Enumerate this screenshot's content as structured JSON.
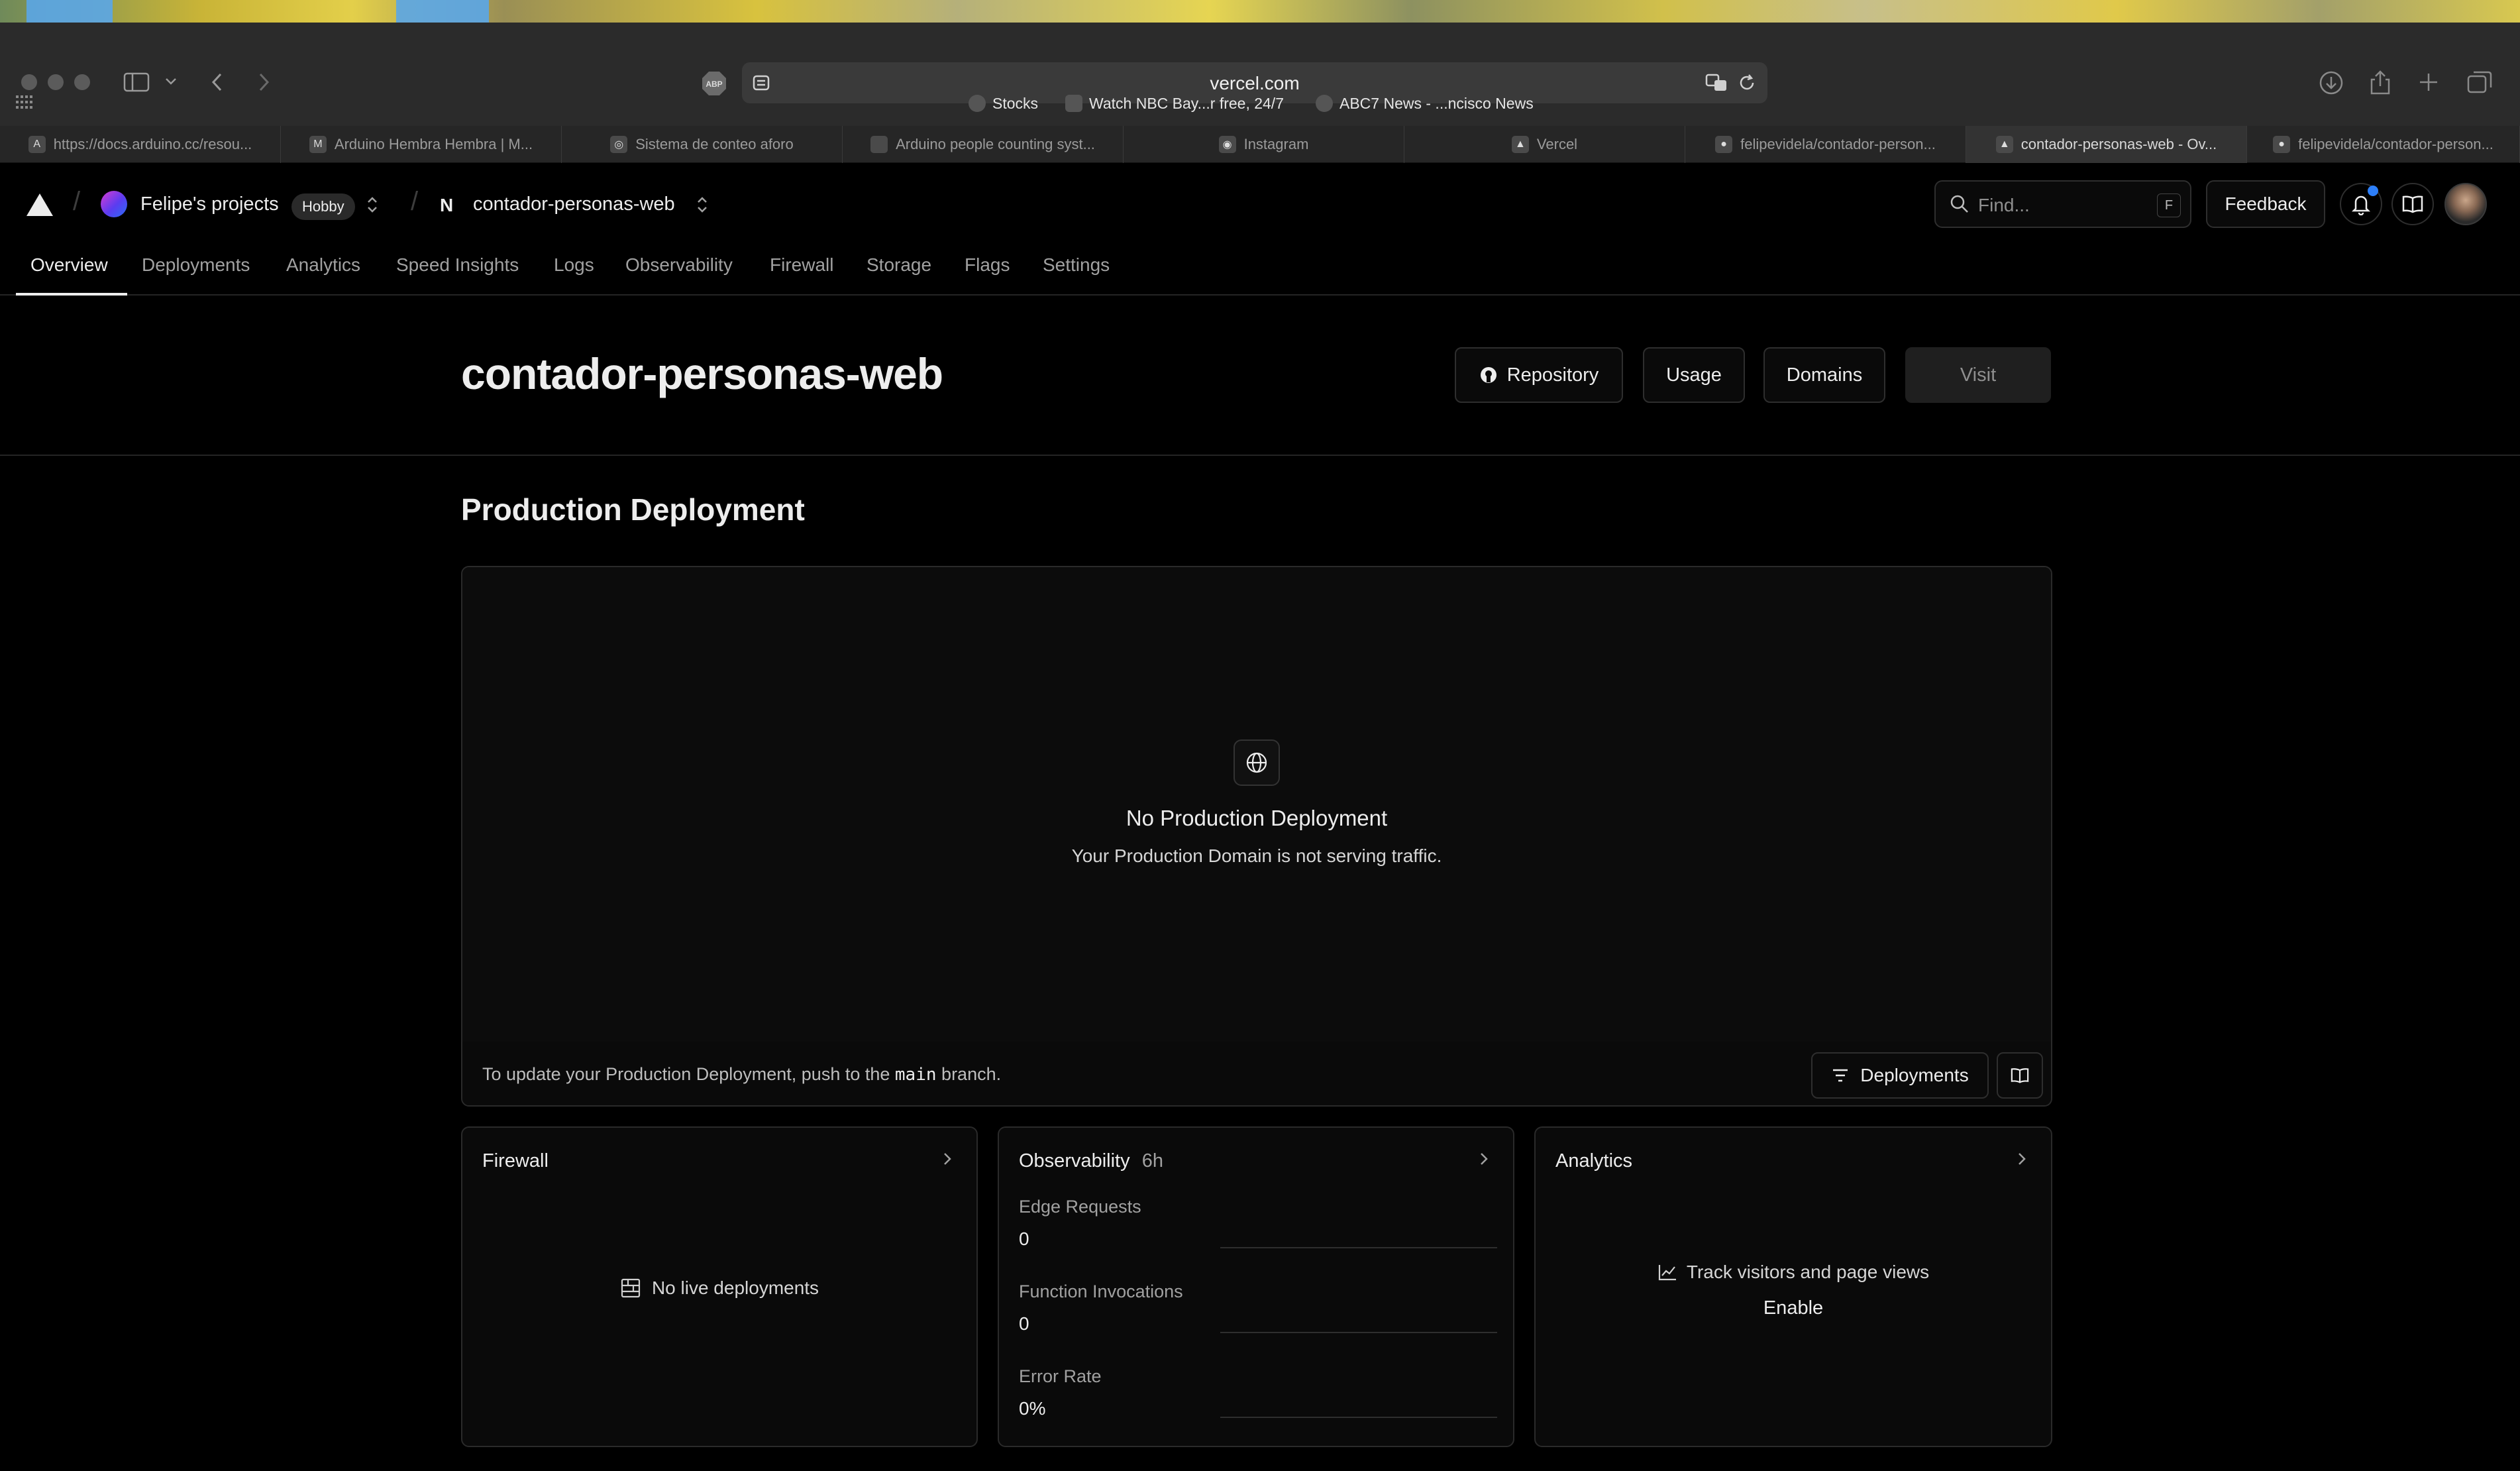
{
  "browser": {
    "url": "vercel.com",
    "bookmarks": [
      {
        "label": "Stocks"
      },
      {
        "label": "Watch NBC Bay...r free, 24/7"
      },
      {
        "label": "ABC7 News - ...ncisco News"
      }
    ],
    "tabs": [
      {
        "label": "https://docs.arduino.cc/resou..."
      },
      {
        "label": "Arduino Hembra Hembra | M..."
      },
      {
        "label": "Sistema de conteo aforo"
      },
      {
        "label": "Arduino people counting syst..."
      },
      {
        "label": "Instagram"
      },
      {
        "label": "Vercel"
      },
      {
        "label": "felipevidela/contador-person..."
      },
      {
        "label": "contador-personas-web - Ov..."
      },
      {
        "label": "felipevidela/contador-person..."
      }
    ],
    "active_tab_index": 7
  },
  "header": {
    "team_name": "Felipe's projects",
    "plan_badge": "Hobby",
    "project_name": "contador-personas-web",
    "find_placeholder": "Find...",
    "find_shortcut": "F",
    "feedback_label": "Feedback"
  },
  "nav": {
    "items": [
      {
        "label": "Overview",
        "active": true
      },
      {
        "label": "Deployments"
      },
      {
        "label": "Analytics"
      },
      {
        "label": "Speed Insights"
      },
      {
        "label": "Logs"
      },
      {
        "label": "Observability"
      },
      {
        "label": "Firewall"
      },
      {
        "label": "Storage"
      },
      {
        "label": "Flags"
      },
      {
        "label": "Settings"
      }
    ]
  },
  "project": {
    "title": "contador-personas-web",
    "buttons": {
      "repository": "Repository",
      "usage": "Usage",
      "domains": "Domains",
      "visit": "Visit"
    }
  },
  "production": {
    "heading": "Production Deployment",
    "empty_title": "No Production Deployment",
    "empty_subtitle": "Your Production Domain is not serving traffic.",
    "footer_prefix": "To update your Production Deployment, push to the",
    "footer_branch": "main",
    "footer_suffix": "branch.",
    "deployments_button": "Deployments"
  },
  "cards": {
    "firewall": {
      "title": "Firewall",
      "empty": "No live deployments"
    },
    "observability": {
      "title": "Observability",
      "range": "6h",
      "metrics": [
        {
          "label": "Edge Requests",
          "value": "0"
        },
        {
          "label": "Function Invocations",
          "value": "0"
        },
        {
          "label": "Error Rate",
          "value": "0%"
        }
      ]
    },
    "analytics": {
      "title": "Analytics",
      "message": "Track visitors and page views",
      "enable": "Enable"
    }
  }
}
